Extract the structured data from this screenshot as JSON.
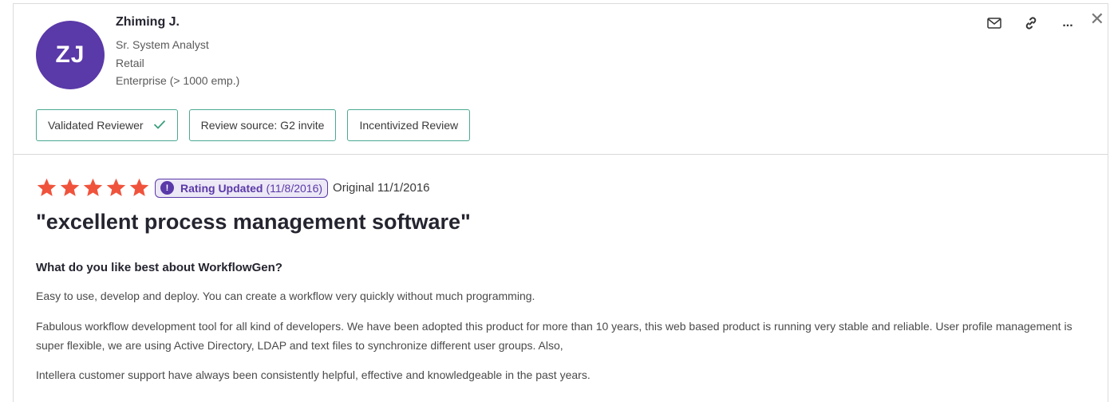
{
  "reviewer": {
    "initials": "ZJ",
    "name": "Zhiming J.",
    "title": "Sr. System Analyst",
    "industry": "Retail",
    "company_size": "Enterprise (> 1000 emp.)",
    "avatar_color": "#5a39a8"
  },
  "actions": {
    "email_icon": "envelope-icon",
    "link_icon": "link-icon",
    "more_label": "...",
    "close_label": "✕"
  },
  "badges": [
    {
      "label": "Validated Reviewer",
      "icon": "check-icon"
    },
    {
      "label": "Review source: G2 invite"
    },
    {
      "label": "Incentivized Review"
    }
  ],
  "rating": {
    "stars": 5,
    "max_stars": 5,
    "star_color": "#f0533c",
    "pill_icon": "!",
    "pill_title": "Rating Updated",
    "pill_date": "(11/8/2016)",
    "original": "Original 11/1/2016"
  },
  "review": {
    "title": "\"excellent process management software\"",
    "question": "What do you like best about WorkflowGen?",
    "paragraphs": [
      "Easy to use, develop and deploy. You can create a workflow very quickly without much programming.",
      "Fabulous workflow development tool for all kind of developers. We have been adopted this product for more than 10 years, this web based product is running very stable and reliable. User profile management is super flexible, we are using Active Directory, LDAP and text files to synchronize different user groups. Also,",
      "Intellera customer support have always been consistently helpful, effective and knowledgeable in the past years."
    ]
  }
}
